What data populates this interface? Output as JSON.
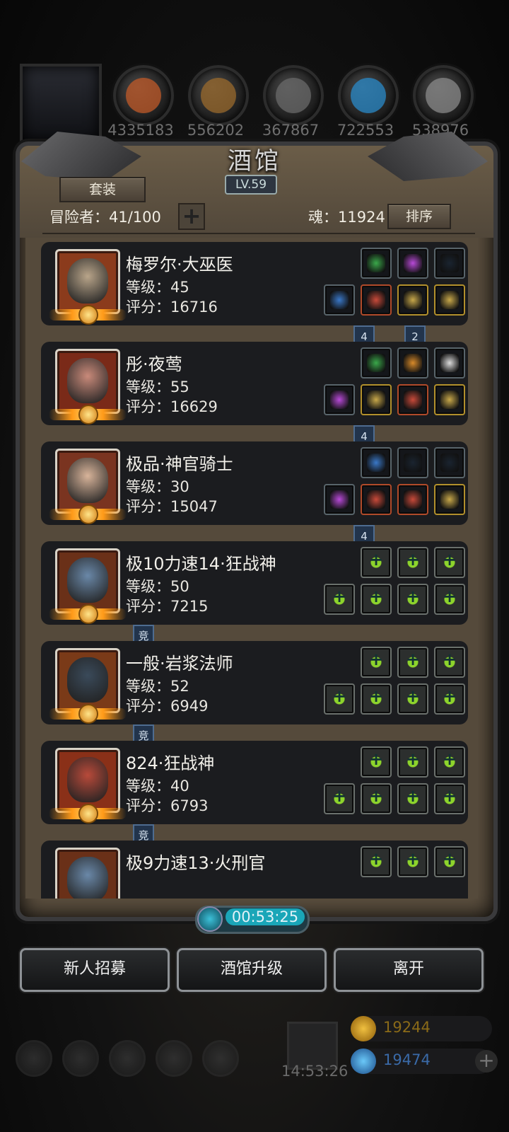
{
  "resources": [
    {
      "name": "ore",
      "value": "4335183",
      "color": "#c05a28"
    },
    {
      "name": "wood",
      "value": "556202",
      "color": "#9a6a2c"
    },
    {
      "name": "stone",
      "value": "367867",
      "color": "#6a6a6a"
    },
    {
      "name": "crystal",
      "value": "722553",
      "color": "#2a8ac8"
    },
    {
      "name": "iron",
      "value": "538976",
      "color": "#8a8a8a"
    }
  ],
  "tavern": {
    "title": "酒馆",
    "level": "LV.59",
    "set_button": "套装",
    "adventurers_label": "冒险者：41/100",
    "soul_label": "魂：11924",
    "sort_button": "排序"
  },
  "heroes": [
    {
      "name": "梅罗尔·大巫医",
      "level": "等级：45",
      "score": "评分：16716",
      "face": "#b9a58a",
      "bg": "#8b3b1c",
      "badges": [
        "4",
        "2"
      ],
      "slots": [
        "green",
        "purple",
        "dark",
        "blue",
        "red",
        "gold",
        "gold"
      ]
    },
    {
      "name": "彤·夜莺",
      "level": "等级：55",
      "score": "评分：16629",
      "face": "#c98a7a",
      "bg": "#7a2a18",
      "badges": [
        "4"
      ],
      "slots": [
        "green",
        "amber",
        "white",
        "purple",
        "gold",
        "red",
        "gold"
      ]
    },
    {
      "name": "极品·神官骑士",
      "level": "等级：30",
      "score": "评分：15047",
      "face": "#d8b49a",
      "bg": "#7a3420",
      "badges": [
        "4"
      ],
      "slots": [
        "blue",
        "dark",
        "dark",
        "purple",
        "red",
        "red",
        "gold"
      ]
    },
    {
      "name": "极10力速14·狂战神",
      "level": "等级：50",
      "score": "评分：7215",
      "face": "#6a88a8",
      "bg": "#6a3018",
      "badges": [
        "竞"
      ],
      "slots": [
        "empty",
        "empty",
        "empty",
        "empty",
        "empty",
        "empty",
        "empty"
      ]
    },
    {
      "name": "一般·岩浆法师",
      "level": "等级：52",
      "score": "评分：6949",
      "face": "#3a4a5a",
      "bg": "#7a3a18",
      "badges": [
        "竞"
      ],
      "slots": [
        "empty",
        "empty",
        "empty",
        "empty",
        "empty",
        "empty",
        "empty"
      ]
    },
    {
      "name": "824·狂战神",
      "level": "等级：40",
      "score": "评分：6793",
      "face": "#b84a3a",
      "bg": "#8a3018",
      "badges": [
        "竞"
      ],
      "slots": [
        "empty",
        "empty",
        "empty",
        "empty",
        "empty",
        "empty",
        "empty"
      ]
    },
    {
      "name": "极9力速13·火刑官",
      "level": "",
      "score": "",
      "face": "#6a88a8",
      "bg": "#6a3018",
      "badges": [],
      "slots": [
        "empty",
        "empty",
        "empty"
      ]
    }
  ],
  "timer": "00:53:25",
  "buttons": {
    "recruit": "新人招募",
    "upgrade": "酒馆升级",
    "leave": "离开"
  },
  "bottom": {
    "time": "14:53:26",
    "gold": "19244",
    "gems": "19474"
  },
  "icons": {
    "timer": "clock-icon",
    "gift": "gift-icon",
    "gold": "gold-coin-icon",
    "gem": "blue-gem-icon",
    "add": "plus-icon"
  }
}
